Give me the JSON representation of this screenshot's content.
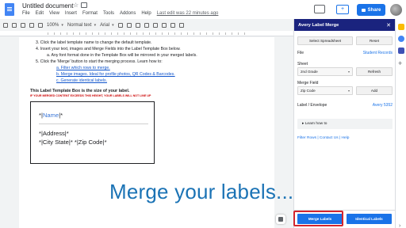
{
  "header": {
    "doc_title": "Untitled document",
    "menu": [
      "File",
      "Edit",
      "View",
      "Insert",
      "Format",
      "Tools",
      "Addons",
      "Help"
    ],
    "last_edit": "Last edit was 22 minutes ago",
    "share_label": "Share"
  },
  "toolbar": {
    "zoom": "100%",
    "style": "Normal text",
    "font": "Arial"
  },
  "document": {
    "steps": [
      {
        "text": "3.  Click the label template name to change the default template.",
        "level": 0,
        "link": false
      },
      {
        "text": "4.  Insert your text, images and Merge Fields into the Label Template Box below.",
        "level": 0,
        "link": false
      },
      {
        "text": "a.  Any font format done in the Template Box will be mirrored in your merged labels.",
        "level": 1,
        "link": false
      },
      {
        "text": "5.  Click the 'Merge' button to start the merging process. Learn how to:",
        "level": 0,
        "link": false
      },
      {
        "text": "a.  Filter which rows to merge.",
        "level": 2,
        "link": true
      },
      {
        "text": "b.  Merge images. Ideal for profile photos, QR Codes & Barcodes.",
        "level": 2,
        "link": true
      },
      {
        "text": "c.  Generate identical labels.",
        "level": 2,
        "link": true
      }
    ],
    "template_title": "This Label Template Box is the size of your label.",
    "template_warning": "IF YOUR MERGED CONTENT EXCEEDS THIS HEIGHT, YOUR LABELS WILL NOT LINE UP",
    "label": {
      "name_prefix": "*|",
      "name_field": "Name",
      "name_suffix": "|*",
      "line2": "*|Address|*",
      "line3": "*|City State|* *|Zip Code|*"
    }
  },
  "overlay_text": "Merge your labels...",
  "panel": {
    "title": "Avery Label Merge",
    "close": "✕",
    "select_spreadsheet": "Select Spreadsheet",
    "reset": "Reset",
    "file_label": "File",
    "file_value": "Student Records",
    "sheet_label": "Sheet",
    "sheet_value": "2nd Grade",
    "refresh": "Refresh",
    "merge_field_label": "Merge Field",
    "merge_field_value": "Zip Code",
    "add": "Add",
    "envelope_label": "Label / Envelope",
    "envelope_value": "Avery 5352",
    "learn": "▸  Learn how to",
    "footer_links": "Filter Rows | Contact Us | Help",
    "merge_labels": "Merge Labels",
    "identical_labels": "Identical Labels"
  },
  "colors": {
    "panel_header": "#1a237e",
    "accent": "#1a73e8",
    "highlight": "#d3252e",
    "overlay": "#1b73b5"
  }
}
